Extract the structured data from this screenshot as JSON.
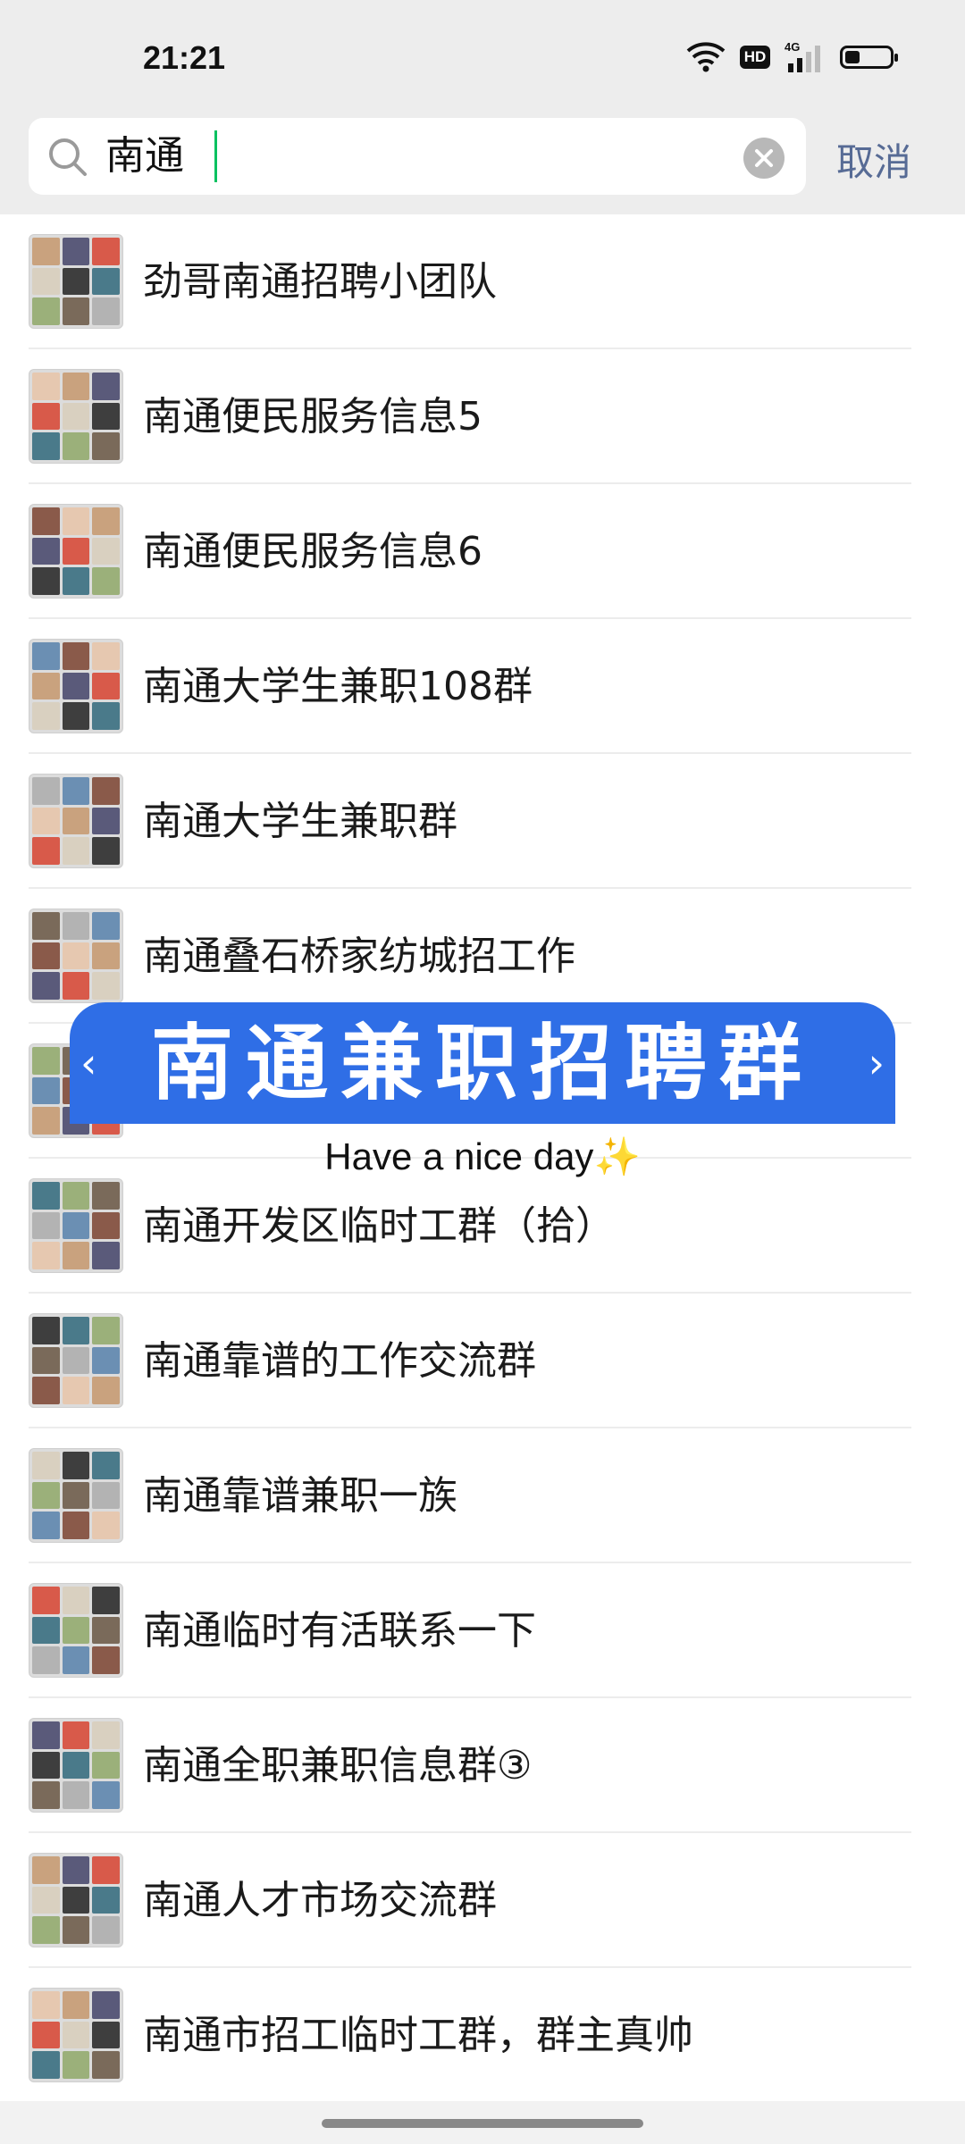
{
  "status_bar": {
    "time": "21:21",
    "hd_label": "HD",
    "network_label": "4G"
  },
  "search": {
    "query": "南通",
    "cancel_label": "取消"
  },
  "results": [
    "劲哥南通招聘小团队",
    "南通便民服务信息5",
    "南通便民服务信息6",
    "南通大学生兼职108群",
    "南通大学生兼职群",
    "南通叠石桥家纺城招工作",
    "",
    "南通开发区临时工群（拾）",
    "南通靠谱的工作交流群",
    "南通靠谱兼职一族",
    "南通临时有活联系一下",
    "南通全职兼职信息群③",
    "南通人才市场交流群",
    "南通市招工临时工群，群主真帅"
  ],
  "banner": {
    "title": "南通兼职招聘群",
    "left_arrow": "‹",
    "right_arrow": "›",
    "caption": "Have a nice day",
    "caption_emoji": "✨",
    "color": "#2f6ee6"
  },
  "colors": {
    "accent_link": "#576b95",
    "caret": "#07c160"
  }
}
